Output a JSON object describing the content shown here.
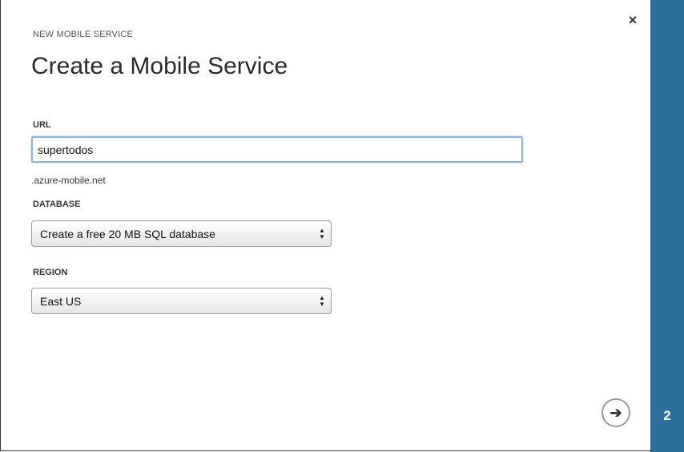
{
  "header": {
    "subtitle": "NEW MOBILE SERVICE",
    "title": "Create a Mobile Service",
    "close_icon": "close-icon",
    "close_glyph": "×"
  },
  "form": {
    "url": {
      "label": "URL",
      "value": "supertodos",
      "suffix": ".azure-mobile.net"
    },
    "database": {
      "label": "DATABASE",
      "selected": "Create a free 20 MB SQL database"
    },
    "region": {
      "label": "REGION",
      "selected": "East US"
    }
  },
  "footer": {
    "next_icon": "arrow-right-icon",
    "next_glyph": "➔"
  },
  "step_rail": {
    "step_number": "2",
    "color": "#2c6e9e"
  }
}
